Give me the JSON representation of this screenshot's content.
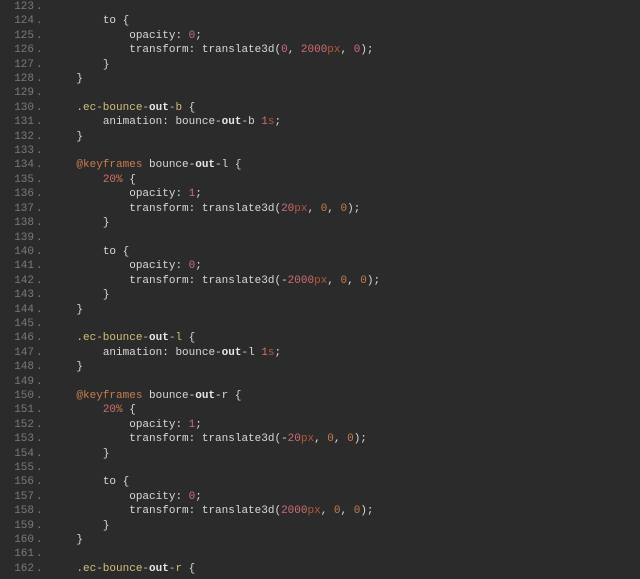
{
  "gutter_suffix": ".",
  "lines": [
    {
      "n": 123,
      "indent": 1,
      "tokens": []
    },
    {
      "n": 124,
      "indent": 2,
      "tokens": [
        {
          "t": "to ",
          "c": "tok-ident"
        },
        {
          "t": "{",
          "c": "tok-brace"
        }
      ]
    },
    {
      "n": 125,
      "indent": 3,
      "tokens": [
        {
          "t": "opacity",
          "c": "tok-prop"
        },
        {
          "t": ": ",
          "c": "tok-punct"
        },
        {
          "t": "0",
          "c": "tok-num"
        },
        {
          "t": ";",
          "c": "tok-punct"
        }
      ]
    },
    {
      "n": 126,
      "indent": 3,
      "tokens": [
        {
          "t": "transform",
          "c": "tok-prop"
        },
        {
          "t": ": ",
          "c": "tok-punct"
        },
        {
          "t": "translate3d",
          "c": "tok-func"
        },
        {
          "t": "(",
          "c": "tok-punct"
        },
        {
          "t": "0",
          "c": "tok-num"
        },
        {
          "t": ", ",
          "c": "tok-punct"
        },
        {
          "t": "2000",
          "c": "tok-num"
        },
        {
          "t": "px",
          "c": "tok-unit"
        },
        {
          "t": ", ",
          "c": "tok-punct"
        },
        {
          "t": "0",
          "c": "tok-num"
        },
        {
          "t": ");",
          "c": "tok-punct"
        }
      ]
    },
    {
      "n": 127,
      "indent": 2,
      "tokens": [
        {
          "t": "}",
          "c": "tok-brace"
        }
      ]
    },
    {
      "n": 128,
      "indent": 1,
      "tokens": [
        {
          "t": "}",
          "c": "tok-brace"
        }
      ]
    },
    {
      "n": 129,
      "indent": 1,
      "tokens": []
    },
    {
      "n": 130,
      "indent": 1,
      "tokens": [
        {
          "t": ".ec-bounce-",
          "c": "tok-sel-pre"
        },
        {
          "t": "out",
          "c": "tok-sel-out"
        },
        {
          "t": "-b ",
          "c": "tok-sel-suf"
        },
        {
          "t": "{",
          "c": "tok-brace"
        }
      ]
    },
    {
      "n": 131,
      "indent": 2,
      "tokens": [
        {
          "t": "animation",
          "c": "tok-prop"
        },
        {
          "t": ": ",
          "c": "tok-punct"
        },
        {
          "t": "bounce-",
          "c": "tok-ident"
        },
        {
          "t": "out",
          "c": "tok-sel-out"
        },
        {
          "t": "-b ",
          "c": "tok-ident"
        },
        {
          "t": "1",
          "c": "tok-num"
        },
        {
          "t": "s",
          "c": "tok-unit"
        },
        {
          "t": ";",
          "c": "tok-punct"
        }
      ]
    },
    {
      "n": 132,
      "indent": 1,
      "tokens": [
        {
          "t": "}",
          "c": "tok-brace"
        }
      ]
    },
    {
      "n": 133,
      "indent": 1,
      "tokens": []
    },
    {
      "n": 134,
      "indent": 1,
      "tokens": [
        {
          "t": "@keyframes",
          "c": "tok-kw"
        },
        {
          "t": " bounce-",
          "c": "tok-ident"
        },
        {
          "t": "out",
          "c": "tok-sel-out"
        },
        {
          "t": "-l ",
          "c": "tok-ident"
        },
        {
          "t": "{",
          "c": "tok-brace"
        }
      ]
    },
    {
      "n": 135,
      "indent": 2,
      "tokens": [
        {
          "t": "20",
          "c": "tok-num"
        },
        {
          "t": "%",
          "c": "tok-percent"
        },
        {
          "t": " {",
          "c": "tok-brace"
        }
      ]
    },
    {
      "n": 136,
      "indent": 3,
      "tokens": [
        {
          "t": "opacity",
          "c": "tok-prop"
        },
        {
          "t": ": ",
          "c": "tok-punct"
        },
        {
          "t": "1",
          "c": "tok-num"
        },
        {
          "t": ";",
          "c": "tok-punct"
        }
      ]
    },
    {
      "n": 137,
      "indent": 3,
      "tokens": [
        {
          "t": "transform",
          "c": "tok-prop"
        },
        {
          "t": ": ",
          "c": "tok-punct"
        },
        {
          "t": "translate3d",
          "c": "tok-func"
        },
        {
          "t": "(",
          "c": "tok-punct"
        },
        {
          "t": "20",
          "c": "tok-num"
        },
        {
          "t": "px",
          "c": "tok-unit"
        },
        {
          "t": ", ",
          "c": "tok-punct"
        },
        {
          "t": "0",
          "c": "tok-zero"
        },
        {
          "t": ", ",
          "c": "tok-punct"
        },
        {
          "t": "0",
          "c": "tok-zero"
        },
        {
          "t": ");",
          "c": "tok-punct"
        }
      ]
    },
    {
      "n": 138,
      "indent": 2,
      "tokens": [
        {
          "t": "}",
          "c": "tok-brace"
        }
      ]
    },
    {
      "n": 139,
      "indent": 1,
      "tokens": []
    },
    {
      "n": 140,
      "indent": 2,
      "tokens": [
        {
          "t": "to ",
          "c": "tok-ident"
        },
        {
          "t": "{",
          "c": "tok-brace"
        }
      ]
    },
    {
      "n": 141,
      "indent": 3,
      "tokens": [
        {
          "t": "opacity",
          "c": "tok-prop"
        },
        {
          "t": ": ",
          "c": "tok-punct"
        },
        {
          "t": "0",
          "c": "tok-num"
        },
        {
          "t": ";",
          "c": "tok-punct"
        }
      ]
    },
    {
      "n": 142,
      "indent": 3,
      "tokens": [
        {
          "t": "transform",
          "c": "tok-prop"
        },
        {
          "t": ": ",
          "c": "tok-punct"
        },
        {
          "t": "translate3d",
          "c": "tok-func"
        },
        {
          "t": "(-",
          "c": "tok-punct"
        },
        {
          "t": "2000",
          "c": "tok-num"
        },
        {
          "t": "px",
          "c": "tok-unit"
        },
        {
          "t": ", ",
          "c": "tok-punct"
        },
        {
          "t": "0",
          "c": "tok-zero"
        },
        {
          "t": ", ",
          "c": "tok-punct"
        },
        {
          "t": "0",
          "c": "tok-zero"
        },
        {
          "t": ");",
          "c": "tok-punct"
        }
      ]
    },
    {
      "n": 143,
      "indent": 2,
      "tokens": [
        {
          "t": "}",
          "c": "tok-brace"
        }
      ]
    },
    {
      "n": 144,
      "indent": 1,
      "tokens": [
        {
          "t": "}",
          "c": "tok-brace"
        }
      ]
    },
    {
      "n": 145,
      "indent": 1,
      "tokens": []
    },
    {
      "n": 146,
      "indent": 1,
      "tokens": [
        {
          "t": ".ec-bounce-",
          "c": "tok-sel-pre"
        },
        {
          "t": "out",
          "c": "tok-sel-out"
        },
        {
          "t": "-l ",
          "c": "tok-sel-suf"
        },
        {
          "t": "{",
          "c": "tok-brace"
        }
      ]
    },
    {
      "n": 147,
      "indent": 2,
      "tokens": [
        {
          "t": "animation",
          "c": "tok-prop"
        },
        {
          "t": ": ",
          "c": "tok-punct"
        },
        {
          "t": "bounce-",
          "c": "tok-ident"
        },
        {
          "t": "out",
          "c": "tok-sel-out"
        },
        {
          "t": "-l ",
          "c": "tok-ident"
        },
        {
          "t": "1",
          "c": "tok-num"
        },
        {
          "t": "s",
          "c": "tok-unit"
        },
        {
          "t": ";",
          "c": "tok-punct"
        }
      ]
    },
    {
      "n": 148,
      "indent": 1,
      "tokens": [
        {
          "t": "}",
          "c": "tok-brace"
        }
      ]
    },
    {
      "n": 149,
      "indent": 1,
      "tokens": []
    },
    {
      "n": 150,
      "indent": 1,
      "tokens": [
        {
          "t": "@keyframes",
          "c": "tok-kw"
        },
        {
          "t": " bounce-",
          "c": "tok-ident"
        },
        {
          "t": "out",
          "c": "tok-sel-out"
        },
        {
          "t": "-r ",
          "c": "tok-ident"
        },
        {
          "t": "{",
          "c": "tok-brace"
        }
      ]
    },
    {
      "n": 151,
      "indent": 2,
      "tokens": [
        {
          "t": "20",
          "c": "tok-num"
        },
        {
          "t": "%",
          "c": "tok-percent"
        },
        {
          "t": " {",
          "c": "tok-brace"
        }
      ]
    },
    {
      "n": 152,
      "indent": 3,
      "tokens": [
        {
          "t": "opacity",
          "c": "tok-prop"
        },
        {
          "t": ": ",
          "c": "tok-punct"
        },
        {
          "t": "1",
          "c": "tok-num"
        },
        {
          "t": ";",
          "c": "tok-punct"
        }
      ]
    },
    {
      "n": 153,
      "indent": 3,
      "tokens": [
        {
          "t": "transform",
          "c": "tok-prop"
        },
        {
          "t": ": ",
          "c": "tok-punct"
        },
        {
          "t": "translate3d",
          "c": "tok-func"
        },
        {
          "t": "(-",
          "c": "tok-punct"
        },
        {
          "t": "20",
          "c": "tok-num"
        },
        {
          "t": "px",
          "c": "tok-unit"
        },
        {
          "t": ", ",
          "c": "tok-punct"
        },
        {
          "t": "0",
          "c": "tok-zero"
        },
        {
          "t": ", ",
          "c": "tok-punct"
        },
        {
          "t": "0",
          "c": "tok-zero"
        },
        {
          "t": ");",
          "c": "tok-punct"
        }
      ]
    },
    {
      "n": 154,
      "indent": 2,
      "tokens": [
        {
          "t": "}",
          "c": "tok-brace"
        }
      ]
    },
    {
      "n": 155,
      "indent": 1,
      "tokens": []
    },
    {
      "n": 156,
      "indent": 2,
      "tokens": [
        {
          "t": "to ",
          "c": "tok-ident"
        },
        {
          "t": "{",
          "c": "tok-brace"
        }
      ]
    },
    {
      "n": 157,
      "indent": 3,
      "tokens": [
        {
          "t": "opacity",
          "c": "tok-prop"
        },
        {
          "t": ": ",
          "c": "tok-punct"
        },
        {
          "t": "0",
          "c": "tok-num"
        },
        {
          "t": ";",
          "c": "tok-punct"
        }
      ]
    },
    {
      "n": 158,
      "indent": 3,
      "tokens": [
        {
          "t": "transform",
          "c": "tok-prop"
        },
        {
          "t": ": ",
          "c": "tok-punct"
        },
        {
          "t": "translate3d",
          "c": "tok-func"
        },
        {
          "t": "(",
          "c": "tok-punct"
        },
        {
          "t": "2000",
          "c": "tok-num"
        },
        {
          "t": "px",
          "c": "tok-unit"
        },
        {
          "t": ", ",
          "c": "tok-punct"
        },
        {
          "t": "0",
          "c": "tok-zero"
        },
        {
          "t": ", ",
          "c": "tok-punct"
        },
        {
          "t": "0",
          "c": "tok-zero"
        },
        {
          "t": ");",
          "c": "tok-punct"
        }
      ]
    },
    {
      "n": 159,
      "indent": 2,
      "tokens": [
        {
          "t": "}",
          "c": "tok-brace"
        }
      ]
    },
    {
      "n": 160,
      "indent": 1,
      "tokens": [
        {
          "t": "}",
          "c": "tok-brace"
        }
      ]
    },
    {
      "n": 161,
      "indent": 1,
      "tokens": []
    },
    {
      "n": 162,
      "indent": 1,
      "tokens": [
        {
          "t": ".ec-bounce-",
          "c": "tok-sel-pre"
        },
        {
          "t": "out",
          "c": "tok-sel-out"
        },
        {
          "t": "-r ",
          "c": "tok-sel-suf"
        },
        {
          "t": "{",
          "c": "tok-brace"
        }
      ]
    }
  ],
  "indent_unit": "    "
}
